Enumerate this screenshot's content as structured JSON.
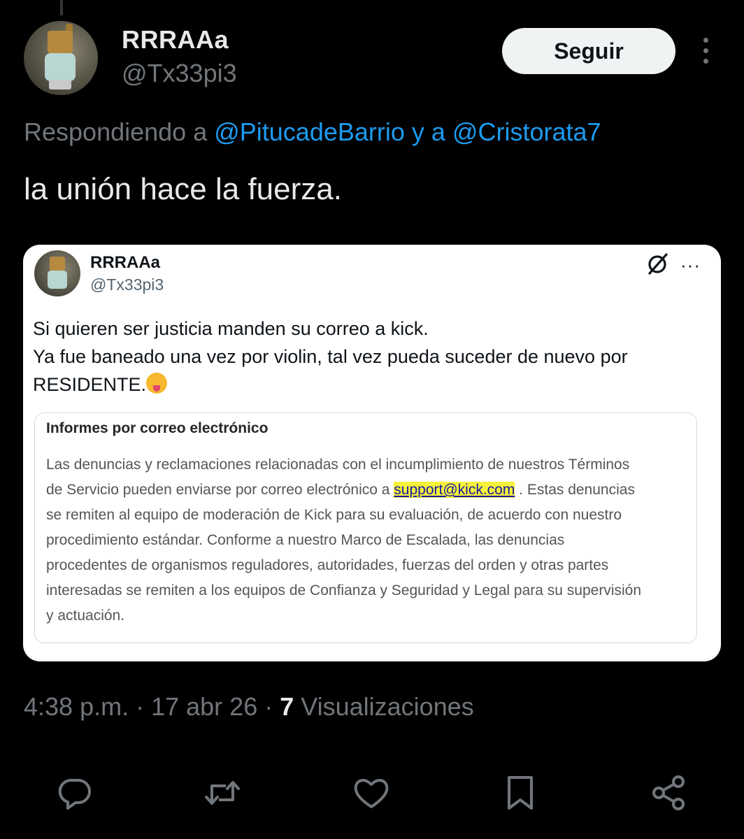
{
  "author": {
    "display_name": "RRRAAa",
    "handle": "@Tx33pi3"
  },
  "follow_label": "Seguir",
  "reply_to": {
    "prefix": "Respondiendo a ",
    "mention1": "@PitucadeBarrio",
    "joiner": " y a ",
    "mention2": "@Cristorata7"
  },
  "tweet_text": "la unión hace la fuerza.",
  "quote": {
    "display_name": "RRRAAa",
    "handle": "@Tx33pi3",
    "text_lines": [
      "Si quieren ser justicia manden su correo a kick.",
      "Ya fue baneado una vez por violin, tal vez pueda suceder de nuevo por",
      "RESIDENTE."
    ],
    "emoji": "squinting-face-with-tongue",
    "more_label": "···",
    "document": {
      "title": "Informes por correo electrónico",
      "lines": [
        "Las denuncias y reclamaciones relacionadas con el incumplimiento de nuestros Términos",
        "de Servicio pueden enviarse por correo electrónico a ",
        "support@kick.com",
        " . Estas denuncias",
        "se remiten al equipo de moderación de Kick para su evaluación, de acuerdo con nuestro",
        "procedimiento estándar. Conforme a nuestro Marco de Escalada, las denuncias",
        "procedentes de organismos reguladores, autoridades, fuerzas del orden y otras partes",
        "interesadas se remiten a los equipos de Confianza y Seguridad y Legal para su supervisión",
        "y actuación."
      ],
      "highlight_color": "#f5f23a"
    }
  },
  "meta": {
    "time": "4:38 p.m.",
    "sep": " · ",
    "date": "17 abr 26",
    "views_count": "7",
    "views_label": " Visualizaciones"
  },
  "icons": {
    "reply": "reply-icon",
    "repost": "repost-icon",
    "like": "like-icon",
    "bookmark": "bookmark-icon",
    "share": "share-icon"
  },
  "colors": {
    "background": "#000000",
    "text_primary": "#e7e9ea",
    "text_secondary": "#71767b",
    "link": "#1d9bf0",
    "card_bg": "#ffffff"
  }
}
